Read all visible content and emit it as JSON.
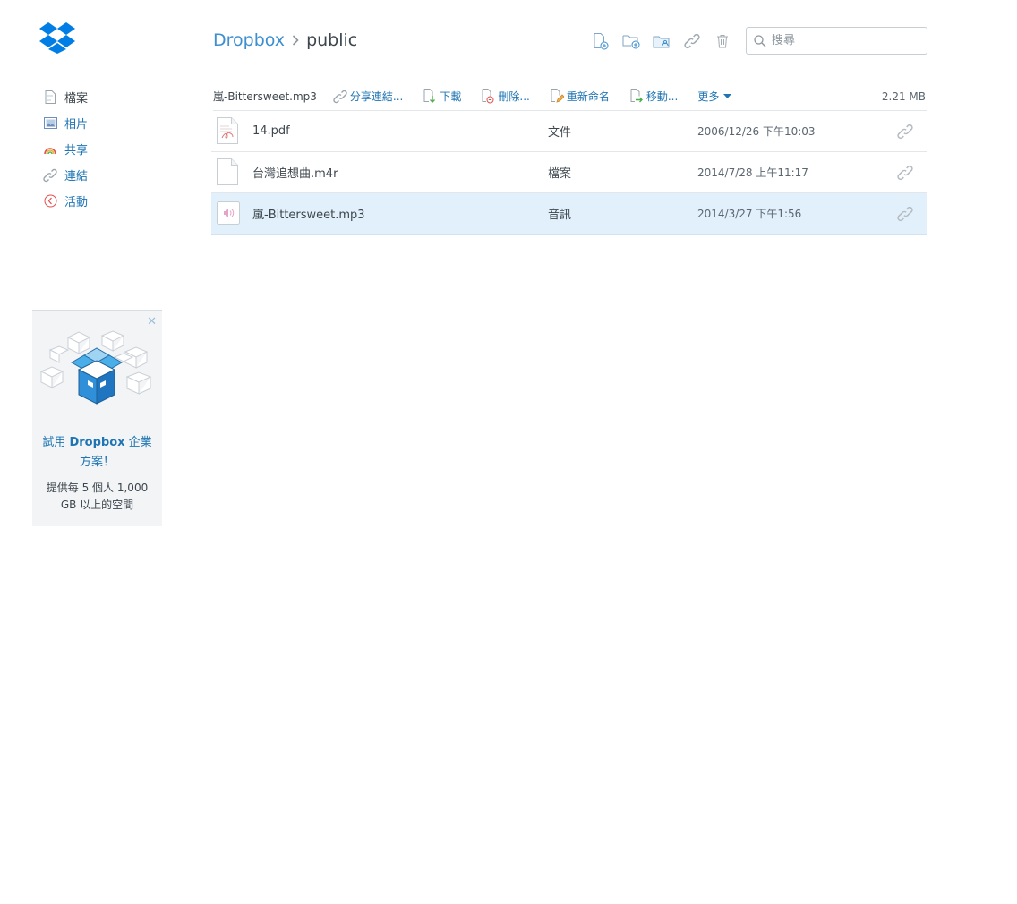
{
  "app": {
    "brand": "Dropbox",
    "brand_color": "#007ee5"
  },
  "breadcrumb": {
    "root": "Dropbox",
    "separator_icon": "chevron-right-icon",
    "current": "public"
  },
  "toolbar": {
    "icons": [
      "new-file-icon",
      "new-folder-icon",
      "shared-folder-icon",
      "link-icon",
      "trash-icon"
    ]
  },
  "search": {
    "placeholder": "搜尋",
    "value": ""
  },
  "sidebar": {
    "items": [
      {
        "label": "檔案",
        "icon": "files-icon",
        "active": true
      },
      {
        "label": "相片",
        "icon": "photos-icon",
        "active": false
      },
      {
        "label": "共享",
        "icon": "sharing-icon",
        "active": false
      },
      {
        "label": "連結",
        "icon": "links-icon",
        "active": false
      },
      {
        "label": "活動",
        "icon": "events-icon",
        "active": false
      }
    ]
  },
  "promo": {
    "title_pre": "試用 ",
    "title_brand": "Dropbox",
    "title_post": " 企業方案！",
    "desc": "提供每 5 個人 1,000 GB 以上的空間",
    "close_icon": "close-icon"
  },
  "action_bar": {
    "selected_name": "嵐-Bittersweet.mp3",
    "share_link": "分享連結...",
    "download": "下載",
    "delete": "刪除...",
    "rename": "重新命名",
    "move": "移動...",
    "more": "更多",
    "size": "2.21 MB"
  },
  "files": [
    {
      "name": "14.pdf",
      "kind": "文件",
      "modified": "2006/12/26 下午10:03",
      "icon": "pdf-file-icon",
      "selected": false
    },
    {
      "name": "台灣追想曲.m4r",
      "kind": "檔案",
      "modified": "2014/7/28 上午11:17",
      "icon": "generic-file-icon",
      "selected": false
    },
    {
      "name": "嵐-Bittersweet.mp3",
      "kind": "音訊",
      "modified": "2014/3/27 下午1:56",
      "icon": "audio-file-icon",
      "selected": true
    }
  ],
  "colors": {
    "link_blue": "#1f75b3",
    "selected_row": "#e1f0fb"
  }
}
